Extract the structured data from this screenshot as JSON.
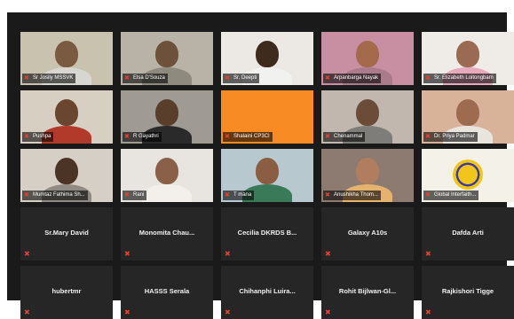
{
  "meeting": {
    "tiles": [
      {
        "name": "Sr Josily MSSVK",
        "video": true,
        "bg": "#c9c2ae",
        "skin": "#7a5a40",
        "cloth": "#d8d6d0",
        "active": true
      },
      {
        "name": "Elsa D'Souza",
        "video": true,
        "bg": "#b8b3a6",
        "skin": "#6e513b",
        "cloth": "#8e8a7e"
      },
      {
        "name": "Sr. Deepti",
        "video": true,
        "bg": "#ece9e4",
        "skin": "#3f2b1e",
        "cloth": "#f1f1ef"
      },
      {
        "name": "Arpanbarga Nayak",
        "video": true,
        "bg": "#c88fa3",
        "skin": "#a46a4c",
        "cloth": "#ab7b8c"
      },
      {
        "name": "Sr. Elizabeth Loitongbam",
        "video": true,
        "bg": "#efebe7",
        "skin": "#9a6a52",
        "cloth": "#e7a9bc"
      },
      {
        "name": "Pushpa",
        "video": true,
        "bg": "#d8cfc3",
        "skin": "#6a4630",
        "cloth": "#b23a2a"
      },
      {
        "name": "R Gayathri",
        "video": true,
        "bg": "#9f9a93",
        "skin": "#5a3e2c",
        "cloth": "#2b2a2a"
      },
      {
        "name": "Shalaini CP3CI",
        "video": false,
        "bg": "#f98b24"
      },
      {
        "name": "Chenammal",
        "video": true,
        "bg": "#c1b7ae",
        "skin": "#6a4c38",
        "cloth": "#7f7d79"
      },
      {
        "name": "Dr. Priya Padmar",
        "video": true,
        "bg": "#d8b39a",
        "skin": "#9c6b50",
        "cloth": "#e8e4de"
      },
      {
        "name": "Mumtaz Fathima Sh...",
        "video": true,
        "bg": "#d6cfc6",
        "skin": "#4b3426",
        "cloth": "#8f8a83"
      },
      {
        "name": "Rani",
        "video": true,
        "bg": "#e8e4df",
        "skin": "#8a6048",
        "cloth": "#f3f0eb"
      },
      {
        "name": "T mana",
        "video": true,
        "bg": "#b7c8cf",
        "skin": "#8b5e44",
        "cloth": "#3a7a58"
      },
      {
        "name": "Anushikha Thom...",
        "video": true,
        "bg": "#8d7a70",
        "skin": "#b07e5e",
        "cloth": "#e6b26f"
      },
      {
        "name": "Global Interfaith...",
        "video": true,
        "bg": "#f4f1e9",
        "skin": "#f0c830",
        "cloth": "#f4f1e9",
        "logo": true
      },
      {
        "name": "Sr.Mary David",
        "video": false
      },
      {
        "name": "Monomita Chau...",
        "video": false
      },
      {
        "name": "Cecilia DKRDS B...",
        "video": false
      },
      {
        "name": "Galaxy A10s",
        "video": false
      },
      {
        "name": "Dafda Arti",
        "video": false
      },
      {
        "name": "hubertmr",
        "video": false
      },
      {
        "name": "HASSS Serala",
        "video": false
      },
      {
        "name": "Chihanphi Luira...",
        "video": false
      },
      {
        "name": "Rohit Bijlwan-Gl...",
        "video": false
      },
      {
        "name": "Rajkishori Tigge",
        "video": false
      }
    ],
    "icons": {
      "mic_muted": "mic-muted-icon"
    },
    "colors": {
      "active_border": "#d7d22e",
      "mic_muted": "#e8412f",
      "tile_bg": "#262626",
      "window_bg": "#1a1a1a"
    }
  }
}
